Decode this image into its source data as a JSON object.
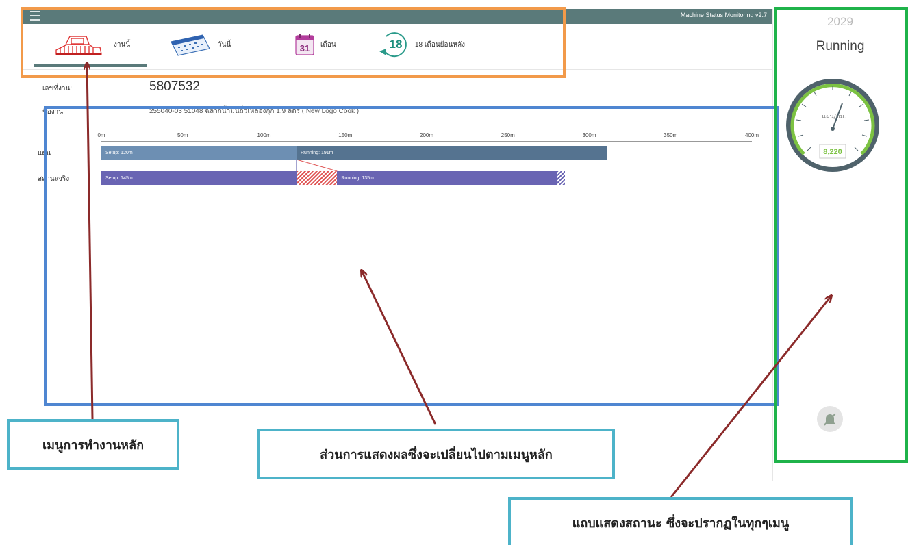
{
  "header": {
    "app_title": "Machine Status Monitoring v2.7"
  },
  "menu": {
    "items": [
      {
        "label": "งานนี้",
        "icon": "machine-icon"
      },
      {
        "label": "วันนี้",
        "icon": "calendar-today-icon"
      },
      {
        "label": "เดือน",
        "icon": "calendar-month-icon",
        "icon_text": "31"
      },
      {
        "label": "18 เดือนย้อนหลัง",
        "icon": "history-18-icon",
        "icon_text": "18"
      }
    ]
  },
  "job": {
    "number_label": "เลขที่งาน:",
    "number": "5807532",
    "name_label": "ชื่องาน:",
    "name": "255040-03 51048 ฉลากน้ำมันถั่วเหลืองกุ๊ก 1.9 ลิตร ( New Logo Cook )"
  },
  "chart_data": {
    "type": "bar",
    "axis_unit": "m",
    "ticks": [
      "0m",
      "50m",
      "100m",
      "150m",
      "200m",
      "250m",
      "300m",
      "350m",
      "400m"
    ],
    "xlim": [
      0,
      400
    ],
    "rows": [
      {
        "label": "แผน",
        "segments": [
          {
            "label": "Setup: 120m",
            "start": 0,
            "duration": 120,
            "color": "#6d8fb3"
          },
          {
            "label": "Running: 191m",
            "start": 120,
            "duration": 191,
            "color": "#557390"
          }
        ]
      },
      {
        "label": "สถานะจริง",
        "segments": [
          {
            "label": "Setup: 145m",
            "start": 0,
            "duration": 120,
            "color": "#6964b3"
          },
          {
            "label": "",
            "start": 120,
            "duration": 25,
            "color": "#e05757",
            "pattern": "hatch"
          },
          {
            "label": "Running: 135m",
            "start": 145,
            "duration": 135,
            "color": "#6964b3"
          },
          {
            "label": "",
            "start": 280,
            "duration": 5,
            "color": "#6964b3",
            "pattern": "hatch"
          }
        ]
      }
    ]
  },
  "status": {
    "machine_no": "2029",
    "state": "Running",
    "gauge": {
      "unit": "แผ่น/ชม.",
      "value": "8,220",
      "accent": "#7cc242",
      "ring": "#4f626b"
    },
    "mute_icon": "bell-off-icon"
  },
  "annotations": {
    "main_menu": "เมนูการทำงานหลัก",
    "display_area": "ส่วนการแสดงผลซึ่งจะเปลี่ยนไปตามเมนูหลัก",
    "status_bar": "แถบแสดงสถานะ ซึ่งจะปรากฏในทุกๆเมนู"
  }
}
